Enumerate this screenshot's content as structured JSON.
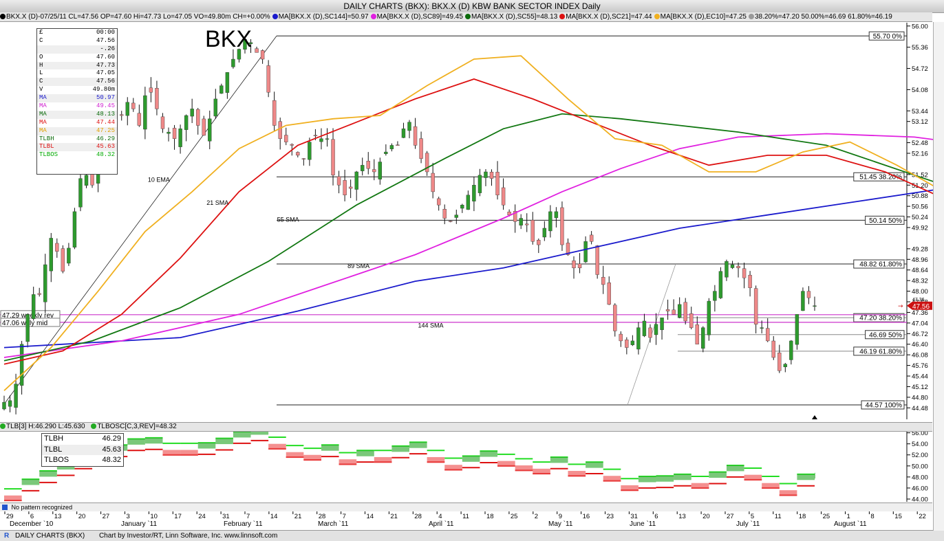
{
  "window": {
    "title": "DAILY CHARTS (BKX): BKX.X (D) KBW BANK SECTOR INDEX Daily",
    "symbol_watermark": "BKX"
  },
  "legend_items": [
    {
      "text": "BKX.X (D)-07/25/11 CL=47.56 OP=47.60 Hi=47.73 Lo=47.05 VO=49.80m CH=+0.00%",
      "color": "#000000"
    },
    {
      "text": "MA[BKX.X (D),SC144]=50.97",
      "color": "#1a1acc"
    },
    {
      "text": "MA[BKX.X (D),SC89]=49.45",
      "color": "#e020e0"
    },
    {
      "text": "MA[BKX.X (D),SC55]=48.13",
      "color": "#0a6a0a"
    },
    {
      "text": "MA[BKX.X (D),SC21]=47.44",
      "color": "#dd1111"
    },
    {
      "text": "MA[BKX.X (D),EC10]=47.25",
      "color": "#f0b020"
    },
    {
      "text": "38.20%=47.20 50.00%=46.69 61.80%=46.19",
      "color": "#999999"
    }
  ],
  "data_window": {
    "header": [
      "£",
      "00:00"
    ],
    "rows": [
      {
        "label": "C",
        "value": "47.56",
        "color": "#000000"
      },
      {
        "label": "",
        "value": "-.26",
        "color": "#000000"
      },
      {
        "label": "O",
        "value": "47.60",
        "color": "#000000"
      },
      {
        "label": "H",
        "value": "47.73",
        "color": "#000000"
      },
      {
        "label": "L",
        "value": "47.05",
        "color": "#000000"
      },
      {
        "label": "C",
        "value": "47.56",
        "color": "#000000"
      },
      {
        "label": "V",
        "value": "49.80m",
        "color": "#000000"
      },
      {
        "label": "MA",
        "value": "50.97",
        "color": "#1a1acc"
      },
      {
        "label": "MA",
        "value": "49.45",
        "color": "#d020d0"
      },
      {
        "label": "MA",
        "value": "48.13",
        "color": "#0a6a0a"
      },
      {
        "label": "MA",
        "value": "47.44",
        "color": "#dd1111"
      },
      {
        "label": "MA",
        "value": "47.25",
        "color": "#e0a000"
      },
      {
        "label": "TLBH",
        "value": "46.29",
        "color": "#0a6a0a"
      },
      {
        "label": "TLBL",
        "value": "45.63",
        "color": "#dd1111"
      },
      {
        "label": "TLBOS",
        "value": "48.32",
        "color": "#00aa00"
      }
    ]
  },
  "indicator_bar": {
    "items": [
      "TLB[3] H:46.290 L:45.630",
      "TLBOSC[C,3,REV]=48.32"
    ]
  },
  "indicator_box": [
    {
      "label": "TLBH",
      "value": "46.29"
    },
    {
      "label": "TLBL",
      "value": "45.63"
    },
    {
      "label": "TLBOS",
      "value": "48.32"
    }
  ],
  "status": {
    "pattern": "No pattern recognized"
  },
  "footer": {
    "left": "DAILY CHARTS (BKX)",
    "right": "Chart by Investor/RT, Linn Software, Inc. www.linnsoft.com"
  },
  "colors": {
    "up_candle": "#2e9a2e",
    "down_candle": "#ee8888",
    "ma144": "#1a1acc",
    "ma89": "#e020e0",
    "ma55": "#117711",
    "ma21": "#dd1111",
    "ema10": "#f0b020",
    "weekly_lines": "#cc33cc",
    "fib_lines": "#222222",
    "tlb_high": "#22dd22",
    "tlb_low": "#dd1111"
  },
  "chart_data": [
    {
      "type": "candlestick",
      "title": "BKX.X (D) KBW BANK SECTOR INDEX Daily",
      "ylim": [
        44.3,
        56.1
      ],
      "y_ticks": [
        "56.00",
        "55.36",
        "54.72",
        "54.08",
        "53.44",
        "53.12",
        "52.48",
        "52.16",
        "51.52",
        "51.20",
        "50.88",
        "50.56",
        "50.24",
        "49.92",
        "49.28",
        "48.96",
        "48.64",
        "48.32",
        "48.00",
        "47.68",
        "47.36",
        "47.04",
        "46.72",
        "46.40",
        "46.08",
        "45.76",
        "45.44",
        "45.12",
        "44.80",
        "44.48"
      ],
      "x_tick_labels": [
        "29",
        "6",
        "13",
        "20",
        "27",
        "3",
        "10",
        "17",
        "24",
        "31",
        "7",
        "14",
        "21",
        "28",
        "7",
        "14",
        "21",
        "28",
        "4",
        "11",
        "18",
        "25",
        "2",
        "9",
        "16",
        "23",
        "31",
        "6",
        "13",
        "20",
        "27",
        "5",
        "11",
        "18",
        "25",
        "1",
        "8",
        "15",
        "22"
      ],
      "month_labels": [
        "December `10",
        "January `11",
        "February `11",
        "March `11",
        "April `11",
        "May `11",
        "June `11",
        "July `11",
        "August `11"
      ],
      "last_price": "47.56",
      "last_price_sub": "47.36",
      "close_values": [
        44.65,
        44.7,
        45.2,
        46.4,
        47.3,
        47.9,
        47.9,
        48.8,
        49.6,
        49.2,
        48.6,
        49.3,
        50.4,
        51.4,
        51.5,
        51.2,
        51.8,
        52.4,
        52.6,
        53.1,
        53.3,
        53.7,
        53.5,
        53.0,
        53.9,
        54.0,
        53.5,
        52.9,
        52.8,
        52.6,
        52.9,
        53.3,
        53.5,
        53.0,
        52.7,
        53.2,
        53.8,
        54.2,
        54.6,
        55.0,
        55.3,
        55.6,
        55.5,
        55.2,
        55.0,
        54.0,
        53.0,
        52.6,
        52.5,
        52.4,
        52.1,
        52.0,
        52.5,
        52.7,
        52.6,
        52.6,
        51.5,
        51.2,
        50.9,
        51.1,
        51.6,
        51.8,
        51.7,
        51.6,
        51.9,
        52.2,
        52.4,
        52.4,
        52.9,
        53.1,
        52.4,
        52.0,
        51.6,
        51.0,
        50.6,
        50.2,
        50.1,
        50.3,
        50.6,
        50.9,
        51.2,
        51.5,
        51.6,
        51.4,
        50.9,
        50.6,
        50.3,
        50.1,
        50.2,
        50.0,
        49.5,
        49.4,
        49.9,
        50.4,
        50.4,
        49.4,
        49.1,
        48.7,
        48.7,
        49.5,
        49.5,
        48.5,
        48.2,
        47.6,
        46.8,
        46.5,
        46.3,
        46.5,
        46.9,
        47.1,
        46.6,
        47.0,
        47.2,
        47.4,
        47.3,
        47.6,
        47.1,
        46.9,
        46.4,
        46.9,
        47.7,
        48.0,
        48.6,
        48.9,
        48.8,
        48.7,
        48.4,
        48.1,
        47.0,
        46.9,
        46.5,
        46.0,
        45.6,
        45.8,
        46.5,
        47.3,
        48.0,
        47.8,
        47.56
      ],
      "series": [
        {
          "name": "MA[BKX.X (D),SC144]",
          "last": 50.97,
          "label": "144 SMA",
          "x": [
            0,
            30,
            50,
            70,
            85,
            100,
            115,
            130,
            145,
            160,
            175,
            190,
            200,
            210,
            224
          ],
          "values": [
            46.3,
            46.6,
            47.4,
            48.3,
            48.7,
            49.3,
            49.9,
            50.3,
            50.7,
            51.1,
            51.3,
            51.4,
            51.45,
            51.3,
            50.97
          ]
        },
        {
          "name": "MA[BKX.X (D),SC89]",
          "last": 49.45,
          "label": "89 SMA",
          "x": [
            0,
            20,
            40,
            55,
            70,
            85,
            95,
            105,
            115,
            125,
            140,
            155,
            170,
            185,
            200,
            212,
            224
          ],
          "values": [
            46.0,
            46.5,
            47.3,
            48.2,
            49.1,
            50.2,
            51.0,
            51.7,
            52.3,
            52.65,
            52.75,
            52.65,
            52.3,
            51.5,
            50.6,
            50.0,
            49.45
          ]
        },
        {
          "name": "MA[BKX.X (D),SC55]",
          "last": 48.13,
          "label": "55 SMA",
          "x": [
            0,
            15,
            30,
            45,
            60,
            75,
            85,
            95,
            105,
            115,
            125,
            140,
            155,
            170,
            185,
            198,
            208,
            218,
            224
          ],
          "values": [
            45.9,
            46.5,
            47.5,
            48.9,
            50.6,
            52.0,
            52.9,
            53.35,
            53.2,
            53.0,
            52.8,
            52.4,
            51.5,
            50.6,
            49.6,
            48.8,
            48.7,
            48.4,
            48.13
          ]
        },
        {
          "name": "MA[BKX.X (D),SC21]",
          "last": 47.44,
          "label": "21 SMA",
          "x": [
            0,
            10,
            20,
            30,
            40,
            50,
            60,
            70,
            80,
            90,
            100,
            110,
            120,
            130,
            140,
            150,
            160,
            170,
            180,
            190,
            200,
            208,
            216,
            224
          ],
          "values": [
            45.8,
            46.2,
            47.3,
            49.0,
            51.0,
            52.4,
            53.1,
            53.8,
            54.4,
            53.8,
            53.1,
            52.4,
            51.8,
            52.1,
            52.1,
            51.6,
            50.8,
            50.4,
            49.5,
            48.0,
            47.1,
            47.5,
            47.6,
            47.44
          ]
        },
        {
          "name": "MA[BKX.X (D),EC10]",
          "last": 47.25,
          "label": "10 EMA",
          "x": [
            0,
            8,
            16,
            24,
            32,
            40,
            48,
            56,
            64,
            72,
            80,
            88,
            96,
            104,
            112,
            120,
            128,
            136,
            144,
            152,
            160,
            168,
            176,
            184,
            192,
            200,
            208,
            214,
            219,
            224
          ],
          "values": [
            45.0,
            46.3,
            48.0,
            49.8,
            51.0,
            52.3,
            53.0,
            53.2,
            53.3,
            54.2,
            55.0,
            55.1,
            53.8,
            52.6,
            52.4,
            51.6,
            51.6,
            52.2,
            52.5,
            51.8,
            51.0,
            51.2,
            50.6,
            49.7,
            47.7,
            47.3,
            47.9,
            48.0,
            46.8,
            47.25
          ]
        }
      ],
      "fib_levels": [
        {
          "label": "55.70 0%",
          "value": 55.7
        },
        {
          "label": "51.45 38.20%",
          "value": 51.45
        },
        {
          "label": "50.14 50%",
          "value": 50.14
        },
        {
          "label": "48.82 61.80%",
          "value": 48.82
        },
        {
          "label": "44.57 100%",
          "value": 44.57
        }
      ],
      "fib_levels_minor": [
        {
          "label": "47.20 38.20%",
          "value": 47.2
        },
        {
          "label": "46.69 50%",
          "value": 46.69
        },
        {
          "label": "46.19 61.80%",
          "value": 46.19
        }
      ],
      "weekly_levels": [
        {
          "label": "47.29 weekly rev",
          "value": 47.29
        },
        {
          "label": "47.06 wkly mid",
          "value": 47.06
        }
      ]
    },
    {
      "type": "line",
      "title": "TLB[3] / TLBOSC[C,3,REV]",
      "ylim": [
        43.5,
        56.2
      ],
      "y_ticks": [
        "56.00",
        "54.00",
        "52.00",
        "50.00",
        "48.00",
        "46.00",
        "44.00"
      ],
      "series": [
        {
          "name": "TLBH",
          "last": 46.29
        },
        {
          "name": "TLBL",
          "last": 45.63
        },
        {
          "name": "TLBOS",
          "last": 48.32
        }
      ]
    }
  ]
}
